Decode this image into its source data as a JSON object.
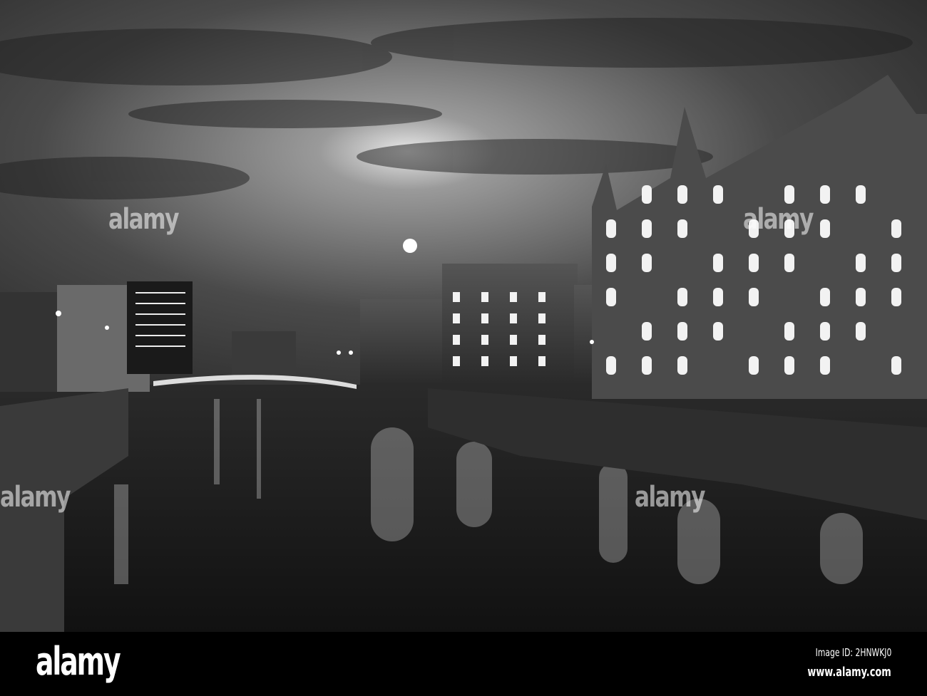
{
  "watermark": {
    "text": "alamy"
  },
  "footer": {
    "logo": "alamy",
    "image_id": "Image ID: 2HNWKJ0",
    "url": "www.alamy.com"
  },
  "colors": {
    "sky": "#5a5a5a",
    "water": "#1c1c1c",
    "light": "#ffffff"
  }
}
